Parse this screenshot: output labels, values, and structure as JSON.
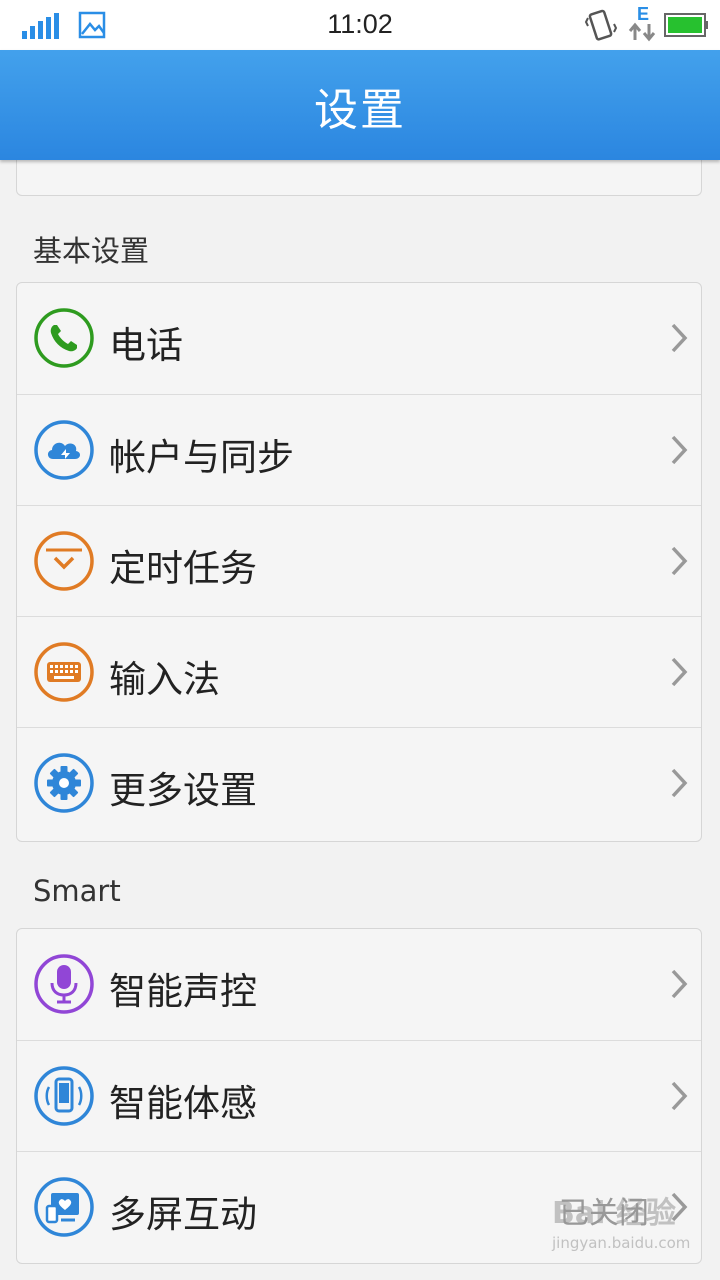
{
  "status_bar": {
    "time": "11:02",
    "network_type": "E",
    "icons": [
      "signal-icon",
      "photo-icon",
      "vibrate-icon",
      "data-arrows-icon",
      "battery-icon"
    ]
  },
  "header": {
    "title": "设置"
  },
  "sections": [
    {
      "title": "基本设置",
      "items": [
        {
          "label": "电话",
          "icon": "phone-icon",
          "color": "#2e9b1f"
        },
        {
          "label": "帐户与同步",
          "icon": "cloud-sync-icon",
          "color": "#2f86d8"
        },
        {
          "label": "定时任务",
          "icon": "clock-icon",
          "color": "#e07b24"
        },
        {
          "label": "输入法",
          "icon": "keyboard-icon",
          "color": "#e07b24"
        },
        {
          "label": "更多设置",
          "icon": "gear-icon",
          "color": "#2f86d8"
        }
      ]
    },
    {
      "title": "Smart",
      "items": [
        {
          "label": "智能声控",
          "icon": "microphone-icon",
          "color": "#9146d6"
        },
        {
          "label": "智能体感",
          "icon": "phone-motion-icon",
          "color": "#2f86d8"
        },
        {
          "label": "多屏互动",
          "icon": "multiscreen-icon",
          "color": "#2f86d8",
          "value": "已关闭"
        }
      ]
    }
  ],
  "watermark": {
    "brand": "Bai 经验",
    "url": "jingyan.baidu.com"
  },
  "colors": {
    "accent": "#3b97e8",
    "background": "#f2f2f2"
  }
}
